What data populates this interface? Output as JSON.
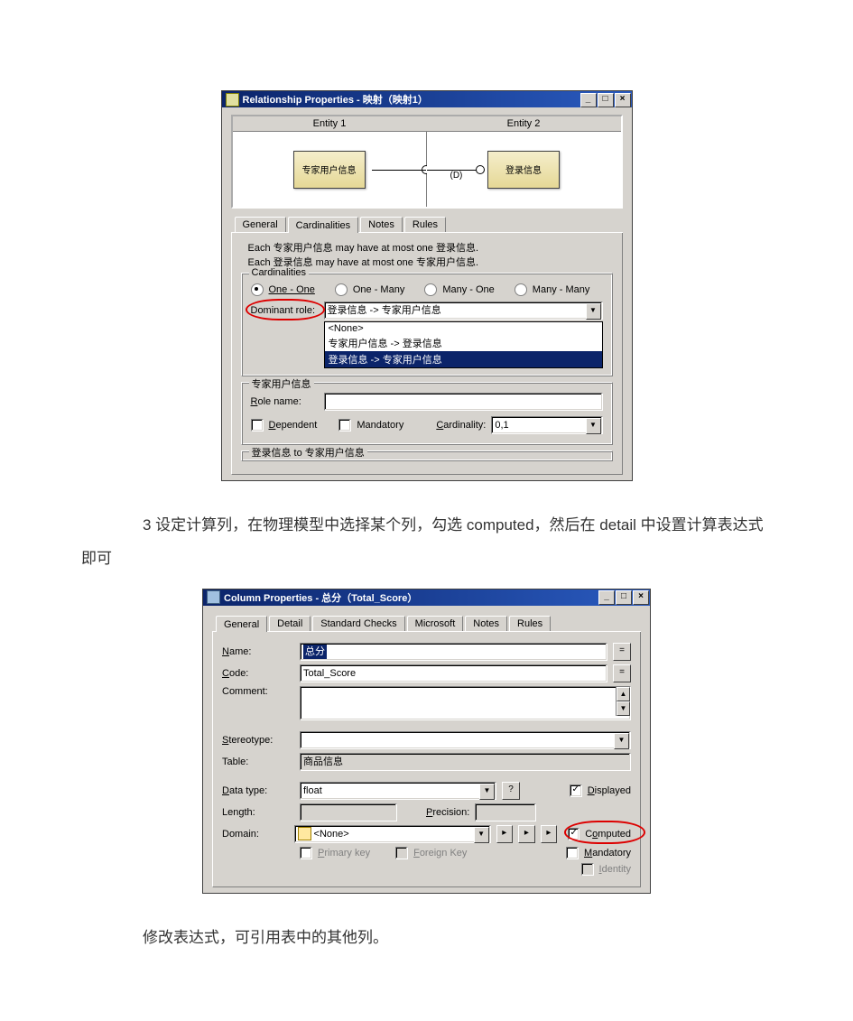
{
  "win1": {
    "title": "Relationship Properties - 映射（映射1）",
    "entity1_header": "Entity 1",
    "entity2_header": "Entity 2",
    "entity1_name": "专家用户信息",
    "entity2_name": "登录信息",
    "link_label": "(D)",
    "tabs": [
      "General",
      "Cardinalities",
      "Notes",
      "Rules"
    ],
    "sentence1": "Each 专家用户信息 may have at most one 登录信息.",
    "sentence2": "Each 登录信息 may have at most one 专家用户信息.",
    "group_card": "Cardinalities",
    "radios": {
      "one_one": "One - One",
      "one_many": "One - Many",
      "many_one": "Many - One",
      "many_many": "Many - Many"
    },
    "dominant_label": "Dominant role:",
    "dominant_value": "登录信息 -> 专家用户信息",
    "dominant_options": {
      "none": "<None>",
      "opt1": "专家用户信息 -> 登录信息",
      "opt2": "登录信息 -> 专家用户信息"
    },
    "sub_group": "专家用户信息",
    "rolename_label": "Role name:",
    "dependent_label": "Dependent",
    "mandatory_label": "Mandatory",
    "cardinality_label": "Cardinality:",
    "cardinality_value": "0,1",
    "footer_group": "登录信息 to 专家用户信息"
  },
  "para1": "3  设定计算列，在物理模型中选择某个列，勾选 computed，然后在 detail 中设置计算表达式即可",
  "win2": {
    "title": "Column Properties - 总分（Total_Score）",
    "tabs": [
      "General",
      "Detail",
      "Standard Checks",
      "Microsoft",
      "Notes",
      "Rules"
    ],
    "name_label": "Name:",
    "name_value": "总分",
    "code_label": "Code:",
    "code_value": "Total_Score",
    "comment_label": "Comment:",
    "stereotype_label": "Stereotype:",
    "table_label": "Table:",
    "table_value": "商品信息",
    "datatype_label": "Data type:",
    "datatype_value": "float",
    "length_label": "Length:",
    "precision_label": "Precision:",
    "domain_label": "Domain:",
    "domain_value": "<None>",
    "displayed_label": "Displayed",
    "computed_label": "Computed",
    "mandatory_label": "Mandatory",
    "identity_label": "Identity",
    "primarykey_label": "Primary key",
    "foreignkey_label": "Foreign Key",
    "qmark": "?"
  },
  "para2": "修改表达式，可引用表中的其他列。"
}
